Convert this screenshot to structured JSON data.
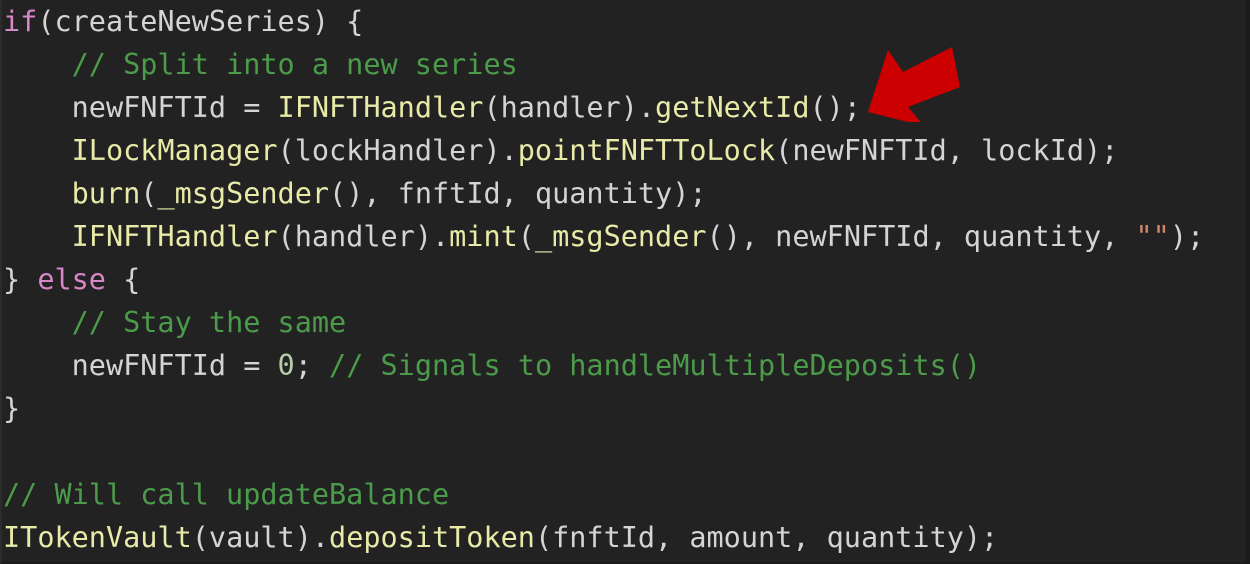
{
  "editor": {
    "background_color": "#222222",
    "default_text_color": "#d4d4d4",
    "language": "solidity",
    "font_size_px": 28
  },
  "syntax_colors": {
    "keyword": "#d887c6",
    "comment": "#4b9b4b",
    "function": "#e8eaa8",
    "identifier": "#d4d4d4",
    "number": "#b5cea8",
    "string": "#d08770"
  },
  "code": {
    "lines": [
      {
        "index": 1,
        "text": "if(createNewSeries) {",
        "tokens": [
          {
            "t": "if",
            "c": "kw"
          },
          {
            "t": "(createNewSeries) {",
            "c": "plain"
          }
        ]
      },
      {
        "index": 2,
        "text": "    // Split into a new series",
        "tokens": [
          {
            "t": "    ",
            "c": "plain"
          },
          {
            "t": "// Split into a new series",
            "c": "cmt"
          }
        ]
      },
      {
        "index": 3,
        "text": "    newFNFTId = IFNFTHandler(handler).getNextId();",
        "tokens": [
          {
            "t": "    newFNFTId = ",
            "c": "plain"
          },
          {
            "t": "IFNFTHandler",
            "c": "fn"
          },
          {
            "t": "(handler).",
            "c": "plain"
          },
          {
            "t": "getNextId",
            "c": "fn"
          },
          {
            "t": "();",
            "c": "plain"
          }
        ]
      },
      {
        "index": 4,
        "text": "    ILockManager(lockHandler).pointFNFTToLock(newFNFTId, lockId);",
        "tokens": [
          {
            "t": "    ",
            "c": "plain"
          },
          {
            "t": "ILockManager",
            "c": "fn"
          },
          {
            "t": "(lockHandler).",
            "c": "plain"
          },
          {
            "t": "pointFNFTToLock",
            "c": "fn"
          },
          {
            "t": "(newFNFTId, lockId);",
            "c": "plain"
          }
        ]
      },
      {
        "index": 5,
        "text": "    burn(_msgSender(), fnftId, quantity);",
        "tokens": [
          {
            "t": "    ",
            "c": "plain"
          },
          {
            "t": "burn",
            "c": "fn"
          },
          {
            "t": "(",
            "c": "plain"
          },
          {
            "t": "_msgSender",
            "c": "fn"
          },
          {
            "t": "(), fnftId, quantity);",
            "c": "plain"
          }
        ]
      },
      {
        "index": 6,
        "text": "    IFNFTHandler(handler).mint(_msgSender(), newFNFTId, quantity, \"\");",
        "tokens": [
          {
            "t": "    ",
            "c": "plain"
          },
          {
            "t": "IFNFTHandler",
            "c": "fn"
          },
          {
            "t": "(handler).",
            "c": "plain"
          },
          {
            "t": "mint",
            "c": "fn"
          },
          {
            "t": "(",
            "c": "plain"
          },
          {
            "t": "_msgSender",
            "c": "fn"
          },
          {
            "t": "(), newFNFTId, quantity, ",
            "c": "plain"
          },
          {
            "t": "\"\"",
            "c": "str"
          },
          {
            "t": ");",
            "c": "plain"
          }
        ]
      },
      {
        "index": 7,
        "text": "} else {",
        "tokens": [
          {
            "t": "} ",
            "c": "plain"
          },
          {
            "t": "else",
            "c": "kw"
          },
          {
            "t": " {",
            "c": "plain"
          }
        ]
      },
      {
        "index": 8,
        "text": "    // Stay the same",
        "tokens": [
          {
            "t": "    ",
            "c": "plain"
          },
          {
            "t": "// Stay the same",
            "c": "cmt"
          }
        ]
      },
      {
        "index": 9,
        "text": "    newFNFTId = 0; // Signals to handleMultipleDeposits()",
        "tokens": [
          {
            "t": "    newFNFTId = ",
            "c": "plain"
          },
          {
            "t": "0",
            "c": "num"
          },
          {
            "t": "; ",
            "c": "plain"
          },
          {
            "t": "// Signals to handleMultipleDeposits()",
            "c": "cmt"
          }
        ]
      },
      {
        "index": 10,
        "text": "}",
        "tokens": [
          {
            "t": "}",
            "c": "plain"
          }
        ]
      },
      {
        "index": 11,
        "text": "",
        "tokens": []
      },
      {
        "index": 12,
        "text": "// Will call updateBalance",
        "tokens": [
          {
            "t": "// Will call updateBalance",
            "c": "cmt"
          }
        ]
      },
      {
        "index": 13,
        "text": "ITokenVault(vault).depositToken(fnftId, amount, quantity);",
        "tokens": [
          {
            "t": "ITokenVault",
            "c": "fn"
          },
          {
            "t": "(vault).",
            "c": "plain"
          },
          {
            "t": "depositToken",
            "c": "fn"
          },
          {
            "t": "(fnftId, amount, quantity);",
            "c": "plain"
          }
        ]
      }
    ]
  },
  "annotation": {
    "type": "arrow",
    "direction": "left",
    "color": "#cc0000",
    "points_at_line": 3,
    "points_at_text": "IFNFTHandler(handler).getNextId();"
  }
}
